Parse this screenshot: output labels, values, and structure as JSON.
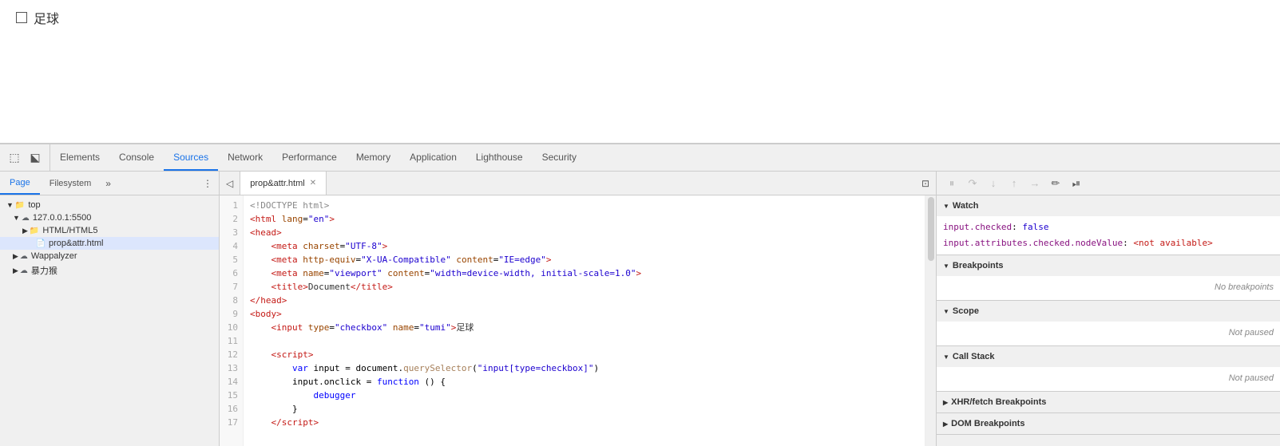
{
  "viewport": {
    "checkbox_label": "足球"
  },
  "devtools": {
    "tabs": [
      {
        "id": "elements",
        "label": "Elements",
        "active": false
      },
      {
        "id": "console",
        "label": "Console",
        "active": false
      },
      {
        "id": "sources",
        "label": "Sources",
        "active": true
      },
      {
        "id": "network",
        "label": "Network",
        "active": false
      },
      {
        "id": "performance",
        "label": "Performance",
        "active": false
      },
      {
        "id": "memory",
        "label": "Memory",
        "active": false
      },
      {
        "id": "application",
        "label": "Application",
        "active": false
      },
      {
        "id": "lighthouse",
        "label": "Lighthouse",
        "active": false
      },
      {
        "id": "security",
        "label": "Security",
        "active": false
      }
    ]
  },
  "file_panel": {
    "tabs": [
      {
        "id": "page",
        "label": "Page",
        "active": true
      },
      {
        "id": "filesystem",
        "label": "Filesystem",
        "active": false
      }
    ],
    "tree": [
      {
        "id": "top",
        "label": "top",
        "indent": 0,
        "type": "folder-open",
        "arrow": "▼"
      },
      {
        "id": "server",
        "label": "127.0.0.1:5500",
        "indent": 1,
        "type": "cloud",
        "arrow": "▼"
      },
      {
        "id": "html5",
        "label": "HTML/HTML5",
        "indent": 2,
        "type": "folder",
        "arrow": "▶"
      },
      {
        "id": "propattr",
        "label": "prop&attr.html",
        "indent": 3,
        "type": "file",
        "arrow": "",
        "selected": true
      },
      {
        "id": "wappalyzer",
        "label": "Wappalyzer",
        "indent": 1,
        "type": "cloud",
        "arrow": "▶"
      },
      {
        "id": "monkey",
        "label": "暴力猴",
        "indent": 1,
        "type": "cloud",
        "arrow": "▶"
      }
    ]
  },
  "editor": {
    "tab_label": "prop&attr.html",
    "lines": [
      {
        "num": 1,
        "html": "<span class='c-comment'>&lt;!DOCTYPE html&gt;</span>"
      },
      {
        "num": 2,
        "html": "<span class='c-tag'>&lt;html</span> <span class='c-attr'>lang</span>=<span class='c-string'>\"en\"</span><span class='c-tag'>&gt;</span>"
      },
      {
        "num": 3,
        "html": "<span class='c-tag'>&lt;head&gt;</span>"
      },
      {
        "num": 4,
        "html": "    <span class='c-tag'>&lt;meta</span> <span class='c-attr'>charset</span>=<span class='c-string'>\"UTF-8\"</span><span class='c-tag'>&gt;</span>"
      },
      {
        "num": 5,
        "html": "    <span class='c-tag'>&lt;meta</span> <span class='c-attr'>http-equiv</span>=<span class='c-string'>\"X-UA-Compatible\"</span> <span class='c-attr'>content</span>=<span class='c-string'>\"IE=edge\"</span><span class='c-tag'>&gt;</span>"
      },
      {
        "num": 6,
        "html": "    <span class='c-tag'>&lt;meta</span> <span class='c-attr'>name</span>=<span class='c-string'>\"viewport\"</span> <span class='c-attr'>content</span>=<span class='c-string'>\"width=device-width, initial-scale=1.0\"</span><span class='c-tag'>&gt;</span>"
      },
      {
        "num": 7,
        "html": "    <span class='c-tag'>&lt;title&gt;</span><span class='c-text'>Document</span><span class='c-tag'>&lt;/title&gt;</span>"
      },
      {
        "num": 8,
        "html": "<span class='c-tag'>&lt;/head&gt;</span>"
      },
      {
        "num": 9,
        "html": "<span class='c-tag'>&lt;body&gt;</span>"
      },
      {
        "num": 10,
        "html": "    <span class='c-tag'>&lt;input</span> <span class='c-attr'>type</span>=<span class='c-string'>\"checkbox\"</span> <span class='c-attr'>name</span>=<span class='c-string'>\"tumi\"</span><span class='c-tag'>&gt;</span><span class='c-text'>足球</span>"
      },
      {
        "num": 11,
        "html": ""
      },
      {
        "num": 12,
        "html": "    <span class='c-tag'>&lt;script&gt;</span>"
      },
      {
        "num": 13,
        "html": "        <span class='c-keyword'>var</span> input = document.<span class='c-func'>querySelector</span>(<span class='c-string'>\"input[type=checkbox]\"</span>)"
      },
      {
        "num": 14,
        "html": "        input.onclick = <span class='c-keyword'>function</span> () {"
      },
      {
        "num": 15,
        "html": "            <span class='c-keyword'>debugger</span>"
      },
      {
        "num": 16,
        "html": "        }"
      },
      {
        "num": 17,
        "html": "    <span class='c-tag'>&lt;/script&gt;</span>"
      }
    ]
  },
  "debug_panel": {
    "watch": {
      "title": "Watch",
      "items": [
        {
          "key": "input.checked",
          "separator": ": ",
          "value": "false",
          "value_class": "watch-value"
        },
        {
          "key": "input.attributes.checked.nodeValue",
          "separator": ": ",
          "value": "<not available>",
          "value_class": "watch-unavailable"
        }
      ]
    },
    "breakpoints": {
      "title": "Breakpoints",
      "empty_text": "No breakpoints"
    },
    "scope": {
      "title": "Scope",
      "status": "Not paused"
    },
    "call_stack": {
      "title": "Call Stack",
      "status": "Not paused"
    },
    "xhr_breakpoints": {
      "title": "XHR/fetch Breakpoints"
    },
    "dom_breakpoints": {
      "title": "DOM Breakpoints"
    }
  },
  "icons": {
    "inspect": "⬚",
    "device": "⬕",
    "pause": "⏸",
    "step_over": "↷",
    "step_into": "↓",
    "step_out": "↑",
    "step": "→",
    "deactivate": "✏",
    "breakpoints": "⏯",
    "chevron_down": "▼",
    "chevron_right": "▶",
    "more": "»",
    "menu": "⋮"
  }
}
